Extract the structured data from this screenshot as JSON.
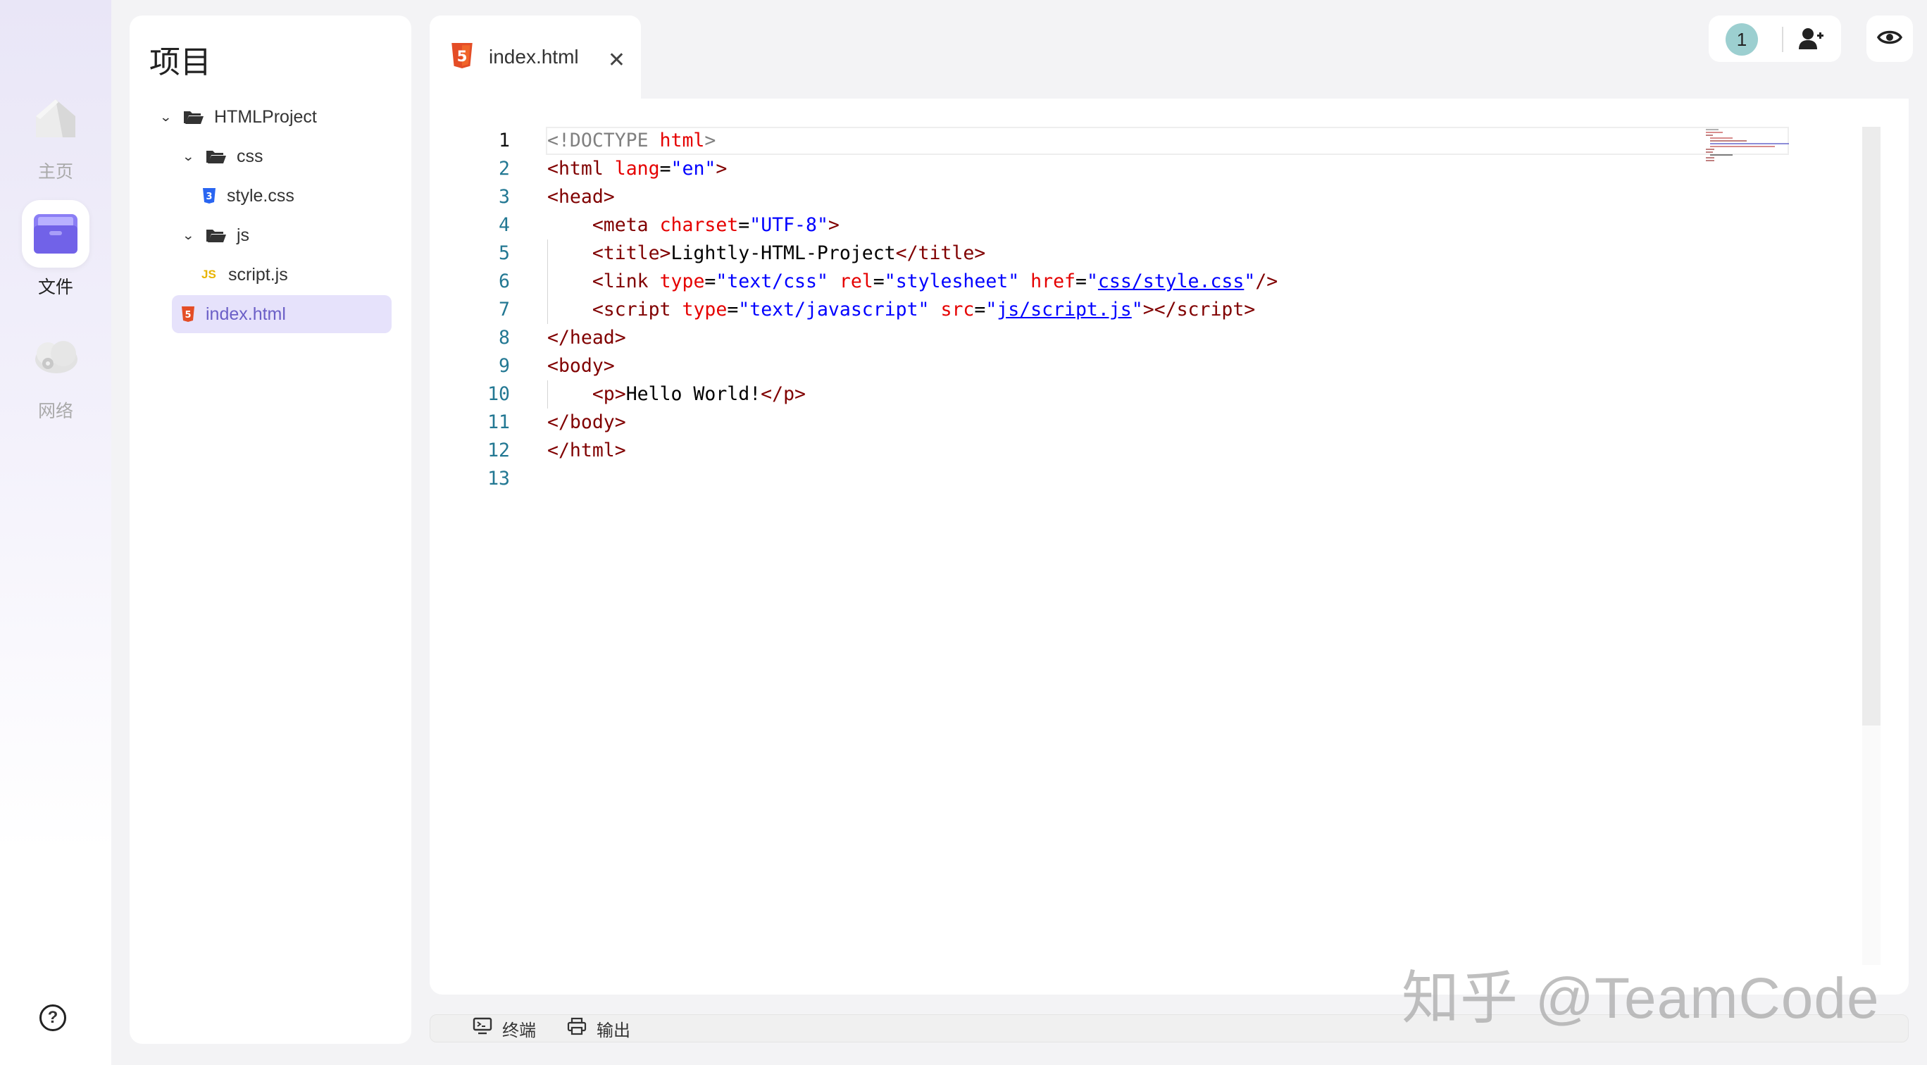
{
  "rail": {
    "items": [
      {
        "label": "主页"
      },
      {
        "label": "文件"
      },
      {
        "label": "网络"
      }
    ],
    "help_label": "?"
  },
  "project": {
    "title": "项目",
    "tree": [
      {
        "label": "HTMLProject"
      },
      {
        "label": "css"
      },
      {
        "label": "style.css"
      },
      {
        "label": "js"
      },
      {
        "label": "script.js"
      },
      {
        "label": "index.html"
      }
    ]
  },
  "editor": {
    "tab_label": "index.html",
    "line_numbers": [
      "1",
      "2",
      "3",
      "4",
      "5",
      "6",
      "7",
      "8",
      "9",
      "10",
      "11",
      "12",
      "13"
    ]
  },
  "collab": {
    "count": "1"
  },
  "bottombar": {
    "terminal_label": "终端",
    "output_label": "输出"
  },
  "watermark": "知乎 @TeamCode",
  "colors": {
    "accent": "#7a6cf0",
    "active_bg": "#e6e2fb",
    "html_icon": "#e44d26",
    "css_icon": "#2965f1",
    "js_icon": "#e8b400"
  }
}
